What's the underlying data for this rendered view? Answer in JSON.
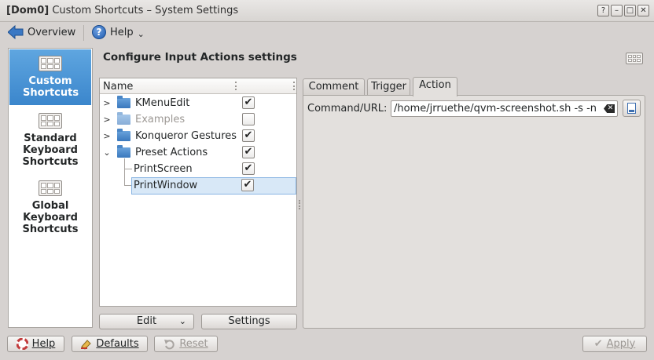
{
  "window": {
    "title_prefix": "[Dom0]",
    "title": " Custom Shortcuts – System Settings",
    "buttons": [
      "?",
      "–",
      "□",
      "✕"
    ]
  },
  "toolbar": {
    "overview_label": "Overview",
    "help_label": "Help",
    "help_glyph": "?",
    "dropdown_glyph": "⌄"
  },
  "sidebar": {
    "items": [
      {
        "label": "Custom Shortcuts",
        "selected": true
      },
      {
        "label": "Standard Keyboard Shortcuts",
        "selected": false
      },
      {
        "label": "Global Keyboard Shortcuts",
        "selected": false
      }
    ]
  },
  "main": {
    "heading": "Configure Input Actions settings"
  },
  "tree": {
    "column_header": "Name",
    "rows": [
      {
        "label": "KMenuEdit",
        "type": "folder",
        "checked": true,
        "enabled": true,
        "expander": ">"
      },
      {
        "label": "Examples",
        "type": "folder",
        "checked": false,
        "enabled": false,
        "expander": ">"
      },
      {
        "label": "Konqueror Gestures",
        "type": "folder",
        "checked": true,
        "enabled": true,
        "expander": ">"
      },
      {
        "label": "Preset Actions",
        "type": "folder",
        "checked": true,
        "enabled": true,
        "expander": "⌄"
      },
      {
        "label": "PrintScreen",
        "type": "action",
        "checked": true,
        "enabled": true
      },
      {
        "label": "PrintWindow",
        "type": "action",
        "checked": true,
        "enabled": true,
        "selected": true
      }
    ],
    "check_glyph": "✔"
  },
  "tree_buttons": {
    "edit_label": "Edit",
    "edit_arrow": "⌄",
    "settings_label": "Settings"
  },
  "tabs": [
    {
      "label": "Comment",
      "active": false
    },
    {
      "label": "Trigger",
      "active": false
    },
    {
      "label": "Action",
      "active": true
    }
  ],
  "action": {
    "command_label": "Command/URL:",
    "command_value": "/home/jrruethe/qvm-screenshot.sh -s -n",
    "clear_glyph": "✕"
  },
  "bottom": {
    "help_label": "Help",
    "defaults_label": "Defaults",
    "reset_label": "Reset",
    "apply_label": "Apply",
    "apply_glyph": "✔"
  },
  "colors": {
    "selection": "#3b86cc",
    "folder": "#3a78bd",
    "window_bg": "#d6d2d0"
  }
}
